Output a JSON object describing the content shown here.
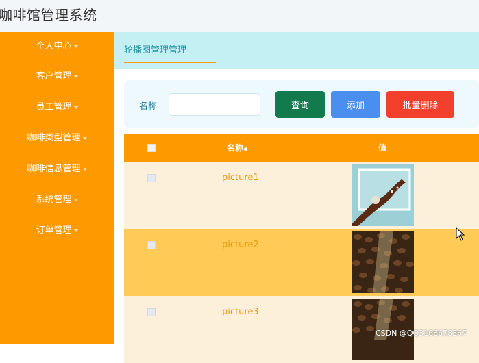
{
  "header": {
    "title": "咖啡馆管理系统"
  },
  "sidebar": {
    "items": [
      {
        "label": "个人中心"
      },
      {
        "label": "客户管理"
      },
      {
        "label": "员工管理"
      },
      {
        "label": "咖啡类型管理"
      },
      {
        "label": "咖啡信息管理"
      },
      {
        "label": "系统管理"
      },
      {
        "label": "订单管理"
      }
    ]
  },
  "tabs": [
    {
      "label": "轮播图管理管理",
      "active": true
    }
  ],
  "search": {
    "label": "名称",
    "value": "",
    "placeholder": ""
  },
  "buttons": {
    "query": "查询",
    "add": "添加",
    "batch_delete": "批量删除"
  },
  "table": {
    "columns": [
      "名称",
      "值"
    ],
    "rows": [
      {
        "name": "picture1",
        "image": "coffee-art-image"
      },
      {
        "name": "picture2",
        "image": "coffee-beans-image"
      },
      {
        "name": "picture3",
        "image": "coffee-beans-image"
      }
    ]
  },
  "colors": {
    "sidebar": "#ff9900",
    "tabbar": "#c4f0f3",
    "row_odd": "#fcf0db",
    "row_even": "#ffca56"
  },
  "watermark": "CSDN @QQ3166678367"
}
